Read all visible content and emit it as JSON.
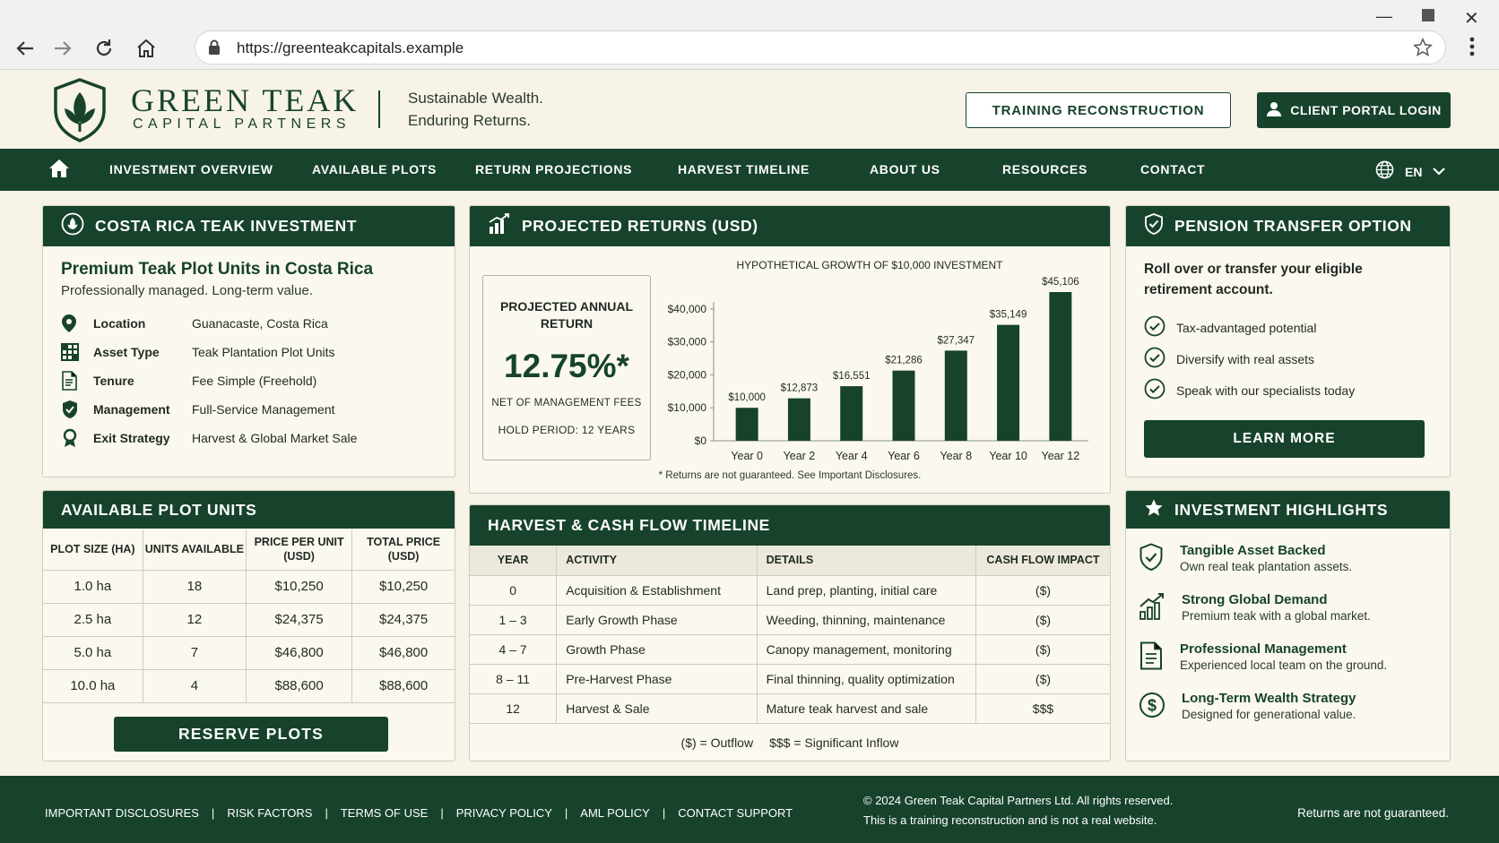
{
  "browser": {
    "url": "https://greenteakcapitals.example"
  },
  "header": {
    "brand_line1": "GREEN TEAK",
    "brand_line2": "CAPITAL PARTNERS",
    "tagline_1": "Sustainable Wealth.",
    "tagline_2": "Enduring Returns.",
    "training_button": "TRAINING RECONSTRUCTION",
    "portal_button": "CLIENT PORTAL LOGIN"
  },
  "nav": {
    "items": [
      "INVESTMENT OVERVIEW",
      "AVAILABLE PLOTS",
      "RETURN PROJECTIONS",
      "HARVEST TIMELINE",
      "ABOUT US",
      "RESOURCES",
      "CONTACT"
    ],
    "language": "EN"
  },
  "investment": {
    "title": "COSTA RICA TEAK INVESTMENT",
    "heading": "Premium Teak Plot Units in Costa Rica",
    "subheading": "Professionally managed. Long-term value.",
    "rows": [
      {
        "key": "Location",
        "value": "Guanacaste, Costa Rica",
        "icon": "map-pin-icon"
      },
      {
        "key": "Asset Type",
        "value": "Teak Plantation Plot Units",
        "icon": "grid-icon"
      },
      {
        "key": "Tenure",
        "value": "Fee Simple (Freehold)",
        "icon": "document-icon"
      },
      {
        "key": "Management",
        "value": "Full-Service Management",
        "icon": "shield-check-icon"
      },
      {
        "key": "Exit Strategy",
        "value": "Harvest & Global Market Sale",
        "icon": "award-icon"
      }
    ]
  },
  "plots": {
    "title": "AVAILABLE PLOT UNITS",
    "headers": [
      "PLOT SIZE (HA)",
      "UNITS AVAILABLE",
      "PRICE PER UNIT (USD)",
      "TOTAL PRICE (USD)"
    ],
    "rows": [
      [
        "1.0 ha",
        "18",
        "$10,250",
        "$10,250"
      ],
      [
        "2.5 ha",
        "12",
        "$24,375",
        "$24,375"
      ],
      [
        "5.0 ha",
        "7",
        "$46,800",
        "$46,800"
      ],
      [
        "10.0 ha",
        "4",
        "$88,600",
        "$88,600"
      ]
    ],
    "button": "RESERVE PLOTS"
  },
  "returns": {
    "title": "PROJECTED RETURNS (USD)",
    "box_label": "PROJECTED ANNUAL RETURN",
    "rate": "12.75%*",
    "net_note": "NET OF MANAGEMENT FEES",
    "hold_note": "HOLD PERIOD: 12 YEARS",
    "disclaimer": "* Returns are not guaranteed. See Important Disclosures."
  },
  "chart_data": {
    "type": "bar",
    "title": "HYPOTHETICAL GROWTH OF $10,000 INVESTMENT",
    "categories": [
      "Year 0",
      "Year 2",
      "Year 4",
      "Year 6",
      "Year 8",
      "Year 10",
      "Year 12"
    ],
    "values": [
      10000,
      12873,
      16551,
      21286,
      27347,
      35149,
      45106
    ],
    "value_labels": [
      "$10,000",
      "$12,873",
      "$16,551",
      "$21,286",
      "$27,347",
      "$35,149",
      "$45,106"
    ],
    "y_ticks": [
      "$0",
      "$10,000",
      "$20,000",
      "$30,000",
      "$40,000"
    ],
    "ylim": [
      0,
      45106
    ],
    "xlabel": "",
    "ylabel": "",
    "grid": false,
    "color": "#17432c"
  },
  "harvest": {
    "title": "HARVEST & CASH FLOW TIMELINE",
    "headers": [
      "YEAR",
      "ACTIVITY",
      "DETAILS",
      "CASH FLOW IMPACT"
    ],
    "rows": [
      [
        "0",
        "Acquisition & Establishment",
        "Land prep, planting, initial care",
        "($)"
      ],
      [
        "1 – 3",
        "Early Growth Phase",
        "Weeding, thinning, maintenance",
        "($)"
      ],
      [
        "4 – 7",
        "Growth Phase",
        "Canopy management, monitoring",
        "($)"
      ],
      [
        "8 – 11",
        "Pre-Harvest Phase",
        "Final thinning, quality optimization",
        "($)"
      ],
      [
        "12",
        "Harvest & Sale",
        "Mature teak harvest and sale",
        "$$$"
      ]
    ],
    "legend_outflow": "($) = Outflow",
    "legend_inflow": "$$$ = Significant Inflow"
  },
  "pension": {
    "title": "PENSION TRANSFER OPTION",
    "intro": "Roll over or transfer your eligible retirement account.",
    "items": [
      "Tax-advantaged potential",
      "Diversify with real assets",
      "Speak with our specialists today"
    ],
    "button": "LEARN MORE"
  },
  "highlights": {
    "title": "INVESTMENT HIGHLIGHTS",
    "items": [
      {
        "title": "Tangible Asset Backed",
        "desc": "Own real teak plantation assets.",
        "icon": "shield-check-icon"
      },
      {
        "title": "Strong Global Demand",
        "desc": "Premium teak with a global market.",
        "icon": "growth-chart-icon"
      },
      {
        "title": "Professional Management",
        "desc": "Experienced local team on the ground.",
        "icon": "document-icon"
      },
      {
        "title": "Long-Term Wealth Strategy",
        "desc": "Designed for generational value.",
        "icon": "dollar-icon"
      }
    ]
  },
  "footer": {
    "links": [
      "IMPORTANT DISCLOSURES",
      "RISK FACTORS",
      "TERMS OF USE",
      "PRIVACY POLICY",
      "AML POLICY",
      "CONTACT SUPPORT"
    ],
    "copyright": "© 2024 Green Teak Capital Partners Ltd. All rights reserved.",
    "training_note": "This is a training reconstruction and is not a real website.",
    "returns_note": "Returns are not guaranteed."
  },
  "colors": {
    "brand_green": "#17432c",
    "background": "#f7f3e6",
    "panel_border": "#c9cfbf"
  }
}
